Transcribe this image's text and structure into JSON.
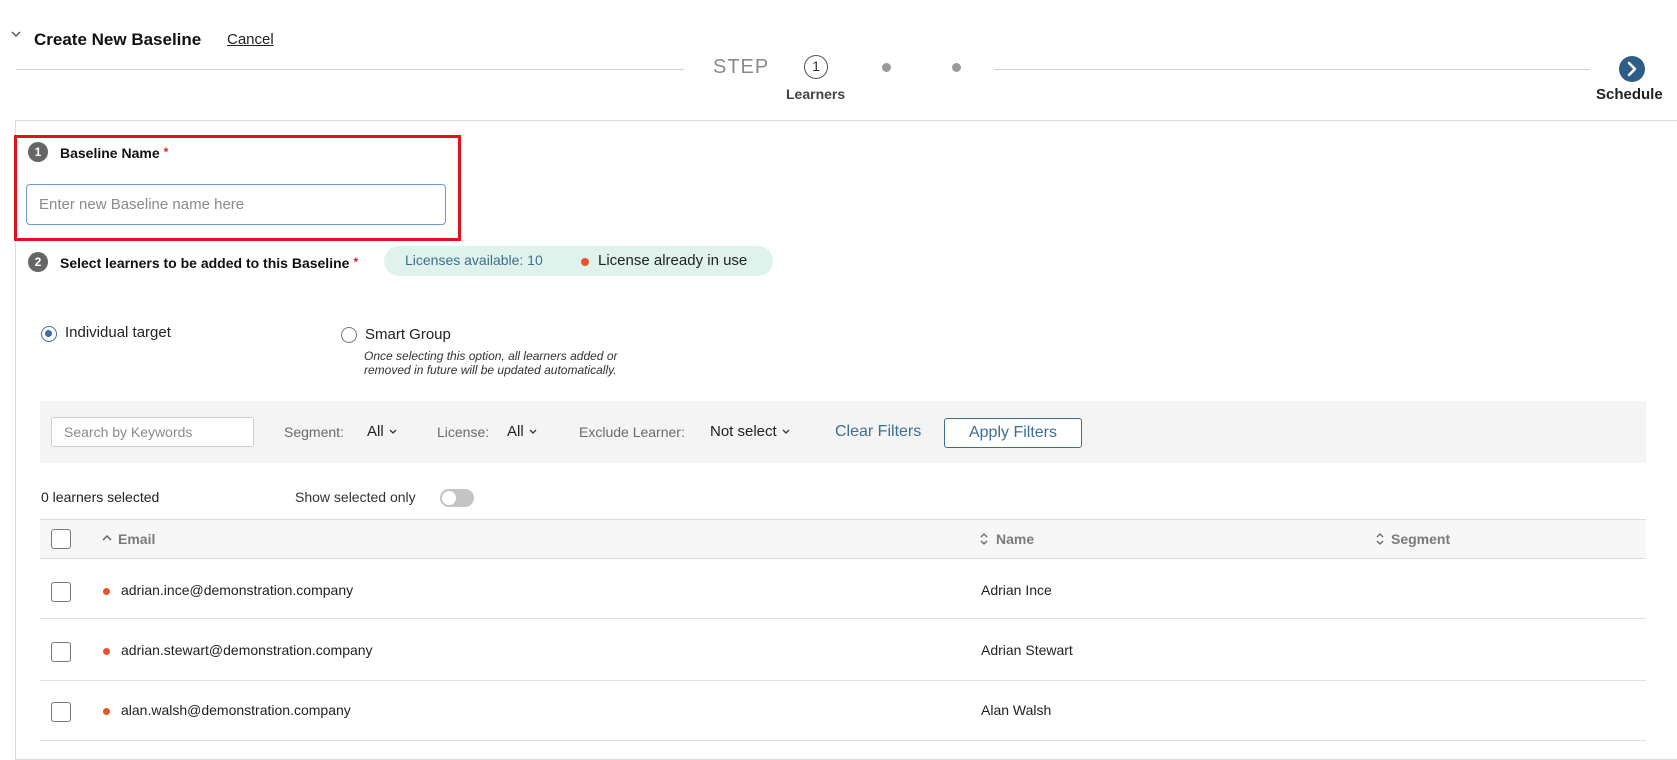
{
  "header": {
    "title": "Create New Baseline",
    "cancel_label": "Cancel"
  },
  "stepper": {
    "step_word": "STEP",
    "current_step_number": "1",
    "current_step_label": "Learners",
    "final_step_label": "Schedule"
  },
  "section1": {
    "number": "1",
    "title": "Baseline Name",
    "required_mark": "*",
    "input_placeholder": "Enter new Baseline name here",
    "input_value": ""
  },
  "section2": {
    "number": "2",
    "title": "Select learners to be added to this Baseline",
    "required_mark": "*",
    "licenses_available": "Licenses available: 10",
    "license_in_use": "License already in use"
  },
  "targeting": {
    "individual_label": "Individual target",
    "individual_selected": true,
    "smart_group_label": "Smart Group",
    "smart_group_note_line1": "Once selecting this option, all learners added or",
    "smart_group_note_line2": "removed in future will be updated automatically."
  },
  "filters": {
    "search_placeholder": "Search by Keywords",
    "segment_label": "Segment:",
    "segment_value": "All",
    "license_label": "License:",
    "license_value": "All",
    "exclude_label": "Exclude Learner:",
    "exclude_value": "Not select",
    "clear_label": "Clear Filters",
    "apply_label": "Apply Filters"
  },
  "selection": {
    "count_text": "0 learners selected",
    "show_selected_label": "Show selected only",
    "show_selected_on": false
  },
  "table": {
    "columns": [
      "Email",
      "Name",
      "Segment"
    ],
    "rows": [
      {
        "email": "adrian.ince@demonstration.company",
        "name": "Adrian Ince",
        "segment": ""
      },
      {
        "email": "adrian.stewart@demonstration.company",
        "name": "Adrian Stewart",
        "segment": ""
      },
      {
        "email": "alan.walsh@demonstration.company",
        "name": "Alan Walsh",
        "segment": ""
      }
    ]
  },
  "colors": {
    "highlight": "#e3101d",
    "accent": "#3d6f95",
    "license_dot": "#e8522d",
    "license_pill": "#dff3ec"
  }
}
